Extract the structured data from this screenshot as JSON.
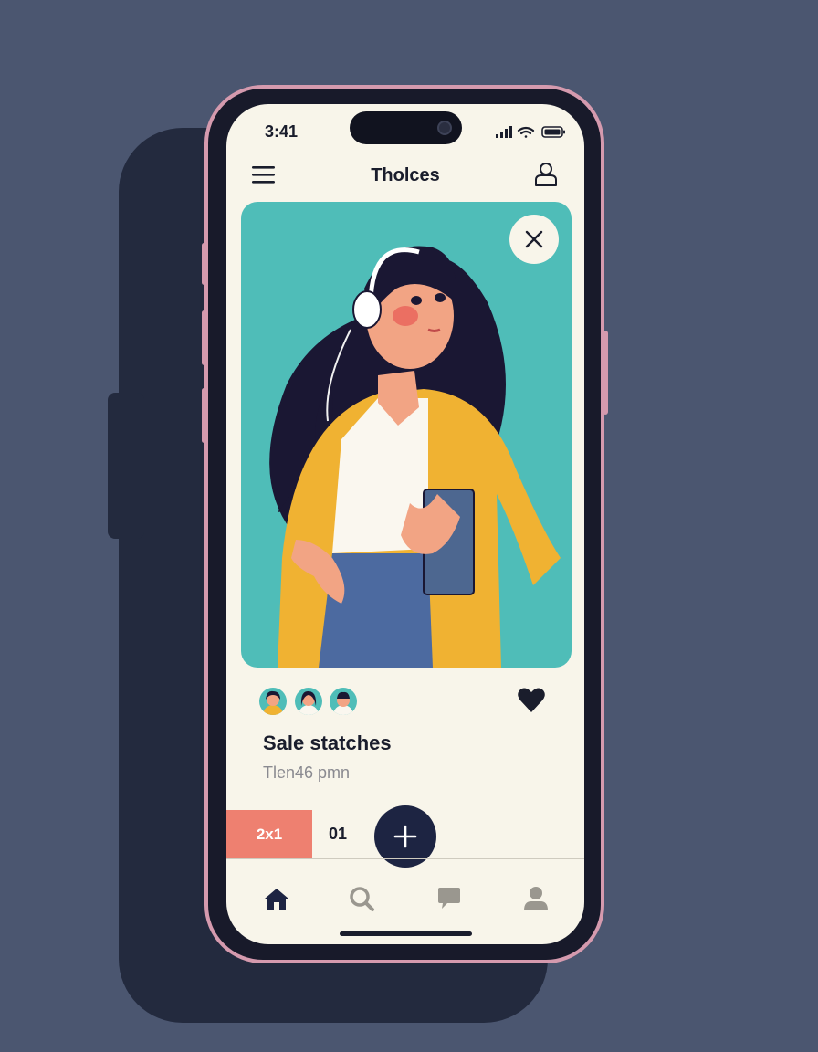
{
  "status_bar": {
    "time": "3:41"
  },
  "header": {
    "title": "Tholces"
  },
  "card": {
    "close_icon": "close-icon",
    "illustration": "woman-with-headphones-holding-tablet"
  },
  "details": {
    "heading": "Sale statches",
    "subtext": "Tlen46 pmn"
  },
  "action_bar": {
    "badge_label": "2x1",
    "count": "01",
    "fab_icon": "plus-icon"
  },
  "tab_bar": {
    "items": [
      "home-icon",
      "search-icon",
      "chat-icon",
      "profile-icon"
    ]
  },
  "colors": {
    "accent_teal": "#4fbdb8",
    "accent_coral": "#ee8070",
    "navy": "#1d2442",
    "screen_bg": "#f8f5ea"
  }
}
